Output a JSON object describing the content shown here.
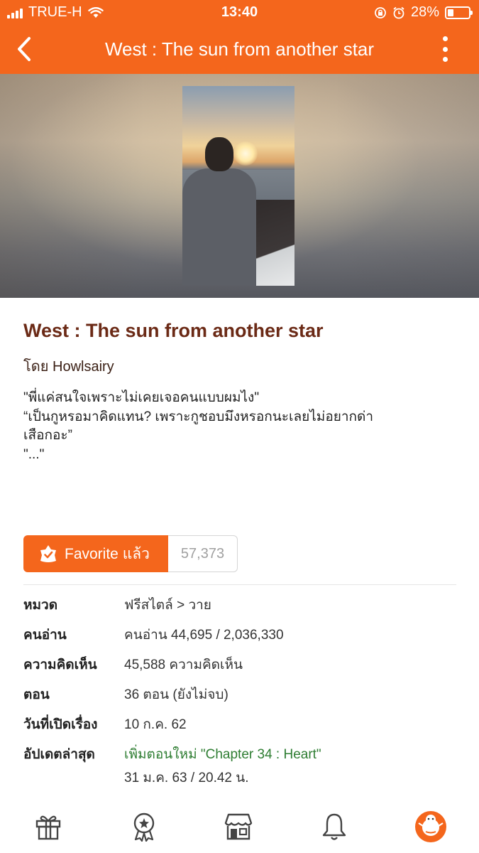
{
  "status_bar": {
    "carrier": "TRUE-H",
    "time": "13:40",
    "battery": "28%",
    "battery_level": 0.28
  },
  "nav": {
    "title": "West : The sun from another star"
  },
  "story": {
    "title": "West : The sun from another star",
    "author": "โดย Howlsairy",
    "synopsis": [
      "\"พี่แค่สนใจเพราะไม่เคยเจอคนแบบผมไง\"",
      "“เป็นกูหรอมาคิดแทน? เพราะกูชอบมึงหรอกนะเลยไม่อยากด่า",
      "เสือกอะ”",
      "\"...\""
    ]
  },
  "favorite": {
    "label": "Favorite แล้ว",
    "count": "57,373"
  },
  "details": [
    {
      "label": "หมวด",
      "value": "ฟรีสไตล์ > วาย"
    },
    {
      "label": "คนอ่าน",
      "value": "คนอ่าน 44,695 / 2,036,330"
    },
    {
      "label": "ความคิดเห็น",
      "value": "45,588 ความคิดเห็น"
    },
    {
      "label": "ตอน",
      "value": "36 ตอน (ยังไม่จบ)"
    },
    {
      "label": "วันที่เปิดเรื่อง",
      "value": "10 ก.ค. 62"
    },
    {
      "label": "อัปเดตล่าสุด",
      "value": "เพิ่มตอนใหม่ \"Chapter 34 : Heart\"",
      "sub": "31 ม.ค. 63 / 20.42 น."
    }
  ],
  "tabs": [
    "gift-icon",
    "badge-star-icon",
    "store-icon",
    "bell-icon",
    "profile-avatar-icon"
  ],
  "colors": {
    "brand_orange": "#f4661c",
    "title_brown": "#6b2a16",
    "update_green": "#2e7d32"
  }
}
